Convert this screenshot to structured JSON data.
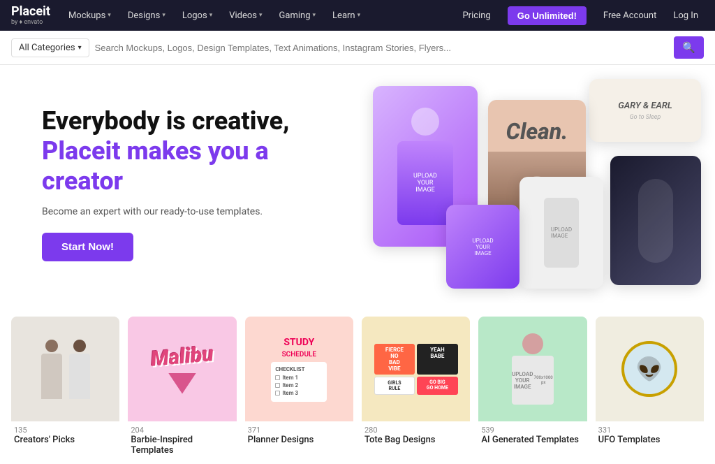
{
  "navbar": {
    "logo": {
      "main": "Placeit",
      "sub": "by ♦ envato"
    },
    "nav_items": [
      {
        "label": "Mockups",
        "has_dropdown": true
      },
      {
        "label": "Designs",
        "has_dropdown": true
      },
      {
        "label": "Logos",
        "has_dropdown": true
      },
      {
        "label": "Videos",
        "has_dropdown": true
      },
      {
        "label": "Gaming",
        "has_dropdown": true
      },
      {
        "label": "Learn",
        "has_dropdown": true
      }
    ],
    "pricing_label": "Pricing",
    "go_unlimited_label": "Go Unlimited!",
    "free_account_label": "Free Account",
    "log_in_label": "Log In"
  },
  "search_bar": {
    "category_label": "All Categories",
    "placeholder": "Search Mockups, Logos, Design Templates, Text Animations, Instagram Stories, Flyers...",
    "search_icon": "🔍"
  },
  "hero": {
    "title_black": "Everybody is creative,",
    "title_purple": "Placeit makes you a creator",
    "subtitle": "Become an expert with our ready-to-use templates.",
    "cta_label": "Start Now!"
  },
  "gallery": {
    "cards": [
      {
        "count": "135",
        "name": "Creators' Picks",
        "bg_class": "gc-creators"
      },
      {
        "count": "204",
        "name": "Barbie-Inspired Templates",
        "bg_class": "gc-barbie"
      },
      {
        "count": "371",
        "name": "Planner Designs",
        "bg_class": "gc-planner"
      },
      {
        "count": "280",
        "name": "Tote Bag Designs",
        "bg_class": "gc-tote"
      },
      {
        "count": "539",
        "name": "AI Generated Templates",
        "bg_class": "gc-ai"
      },
      {
        "count": "331",
        "name": "UFO Templates",
        "bg_class": "gc-ufo"
      }
    ]
  }
}
